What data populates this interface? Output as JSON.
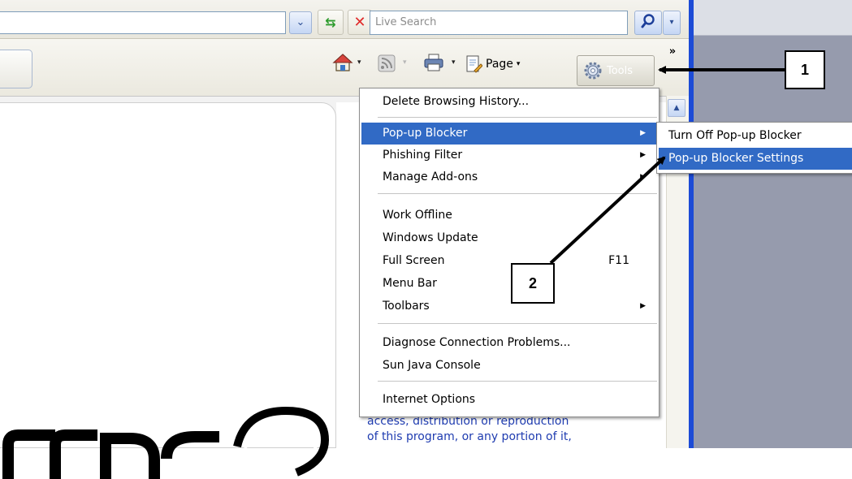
{
  "toolbar": {
    "search_placeholder": "Live Search",
    "address_dropdown_glyph": "⌄",
    "refresh_glyph": "⇆",
    "stop_glyph": "✕",
    "search_options_glyph": "▾",
    "home_dd_glyph": "▾",
    "feed_dd_glyph": "▾",
    "print_dd_glyph": "▾",
    "page_label": "Page",
    "page_dd_glyph": "▾",
    "tools_label": "Tools",
    "more_glyph": "»"
  },
  "tools_menu": {
    "items": [
      {
        "label": "Delete Browsing History..."
      },
      {
        "label": "Pop-up Blocker",
        "submenu": true
      },
      {
        "label": "Phishing Filter",
        "submenu": true
      },
      {
        "label": "Manage Add-ons",
        "submenu": true
      },
      {
        "label": "Work Offline"
      },
      {
        "label": "Windows Update"
      },
      {
        "label": "Full Screen",
        "shortcut": "F11"
      },
      {
        "label": "Menu Bar"
      },
      {
        "label": "Toolbars",
        "submenu": true
      },
      {
        "label": "Diagnose Connection Problems..."
      },
      {
        "label": "Sun Java Console"
      },
      {
        "label": "Internet Options"
      }
    ],
    "arrow_glyph": "▶"
  },
  "popup_submenu": {
    "items": [
      {
        "label": "Turn Off Pop-up Blocker"
      },
      {
        "label": "Pop-up Blocker Settings"
      }
    ]
  },
  "page_content": {
    "text_line_1": "access, distribution or reproduction",
    "text_line_2": "of this program, or any portion of it,"
  },
  "callouts": {
    "one": "1",
    "two": "2"
  },
  "scroll_up_glyph": "▲",
  "colors": {
    "highlight": "#316ac5",
    "window_border": "#1c4bd6",
    "link_text": "#1f3cb0"
  }
}
